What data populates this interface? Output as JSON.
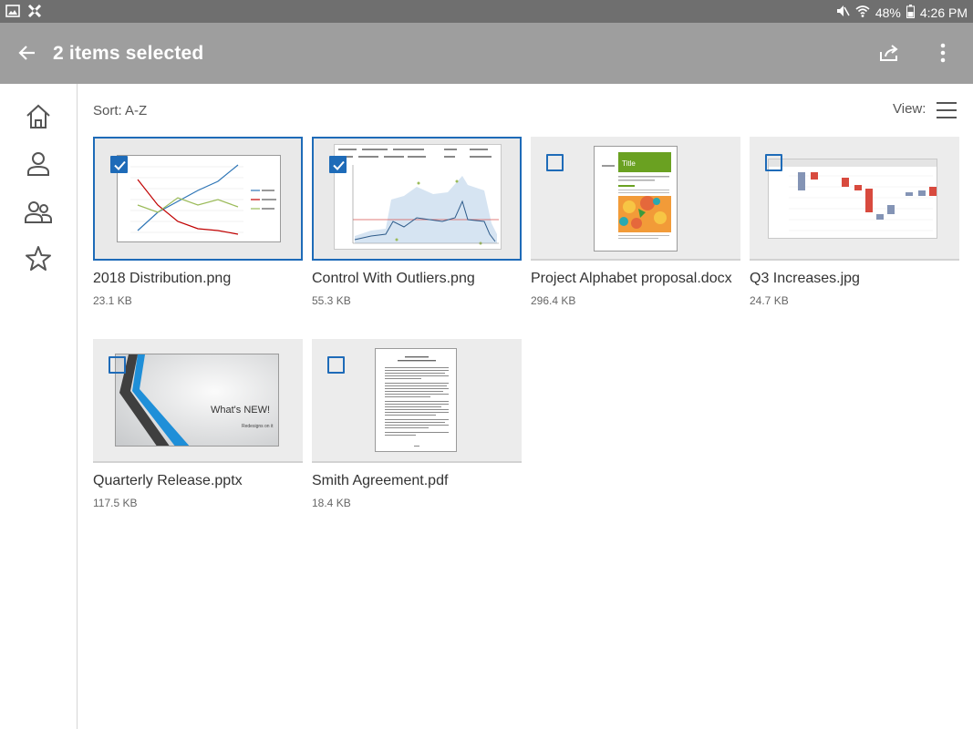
{
  "status": {
    "battery": "48%",
    "time": "4:26 PM"
  },
  "appbar": {
    "title": "2 items selected"
  },
  "toolbar": {
    "sort_label": "Sort: A-Z",
    "view_label": "View:"
  },
  "files": [
    {
      "name": "2018 Distribution.png",
      "size": "23.1 KB",
      "selected": true
    },
    {
      "name": "Control With Outliers.png",
      "size": "55.3 KB",
      "selected": true
    },
    {
      "name": "Project Alphabet proposal.docx",
      "size": "296.4 KB",
      "selected": false
    },
    {
      "name": "Q3 Increases.jpg",
      "size": "24.7 KB",
      "selected": false
    },
    {
      "name": "Quarterly Release.pptx",
      "size": "117.5 KB",
      "selected": false
    },
    {
      "name": "Smith Agreement.pdf",
      "size": "18.4 KB",
      "selected": false
    }
  ],
  "previews": {
    "ppt_title": "What's NEW!",
    "ppt_sub": "Redesigns on it",
    "doc_title": "Title"
  },
  "colors": {
    "accent": "#1e6bb8",
    "appbar": "#9e9e9e",
    "statusbar": "#6f6f6f"
  }
}
